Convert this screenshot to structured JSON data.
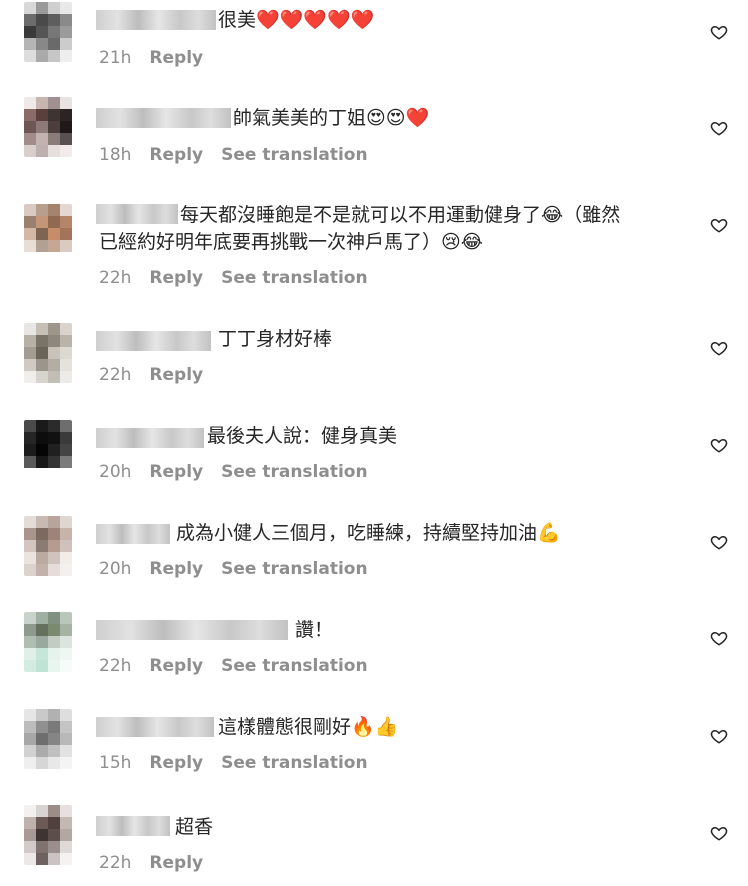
{
  "labels": {
    "reply": "Reply",
    "translate": "See translation"
  },
  "icons": {
    "like": "heart-outline-icon"
  },
  "comments": [
    {
      "text": "很美❤️❤️❤️❤️❤️",
      "time": "21h",
      "translate": false
    },
    {
      "text": "帥氣美美的丁姐😍😍❤️",
      "time": "18h",
      "translate": true
    },
    {
      "text": "每天都沒睡飽是不是就可以不用運動健身了😂（雖然",
      "text2": "已經約好明年底要再挑戰一次神戶馬了）😢😂",
      "time": "22h",
      "translate": true
    },
    {
      "text": "丁丁身材好棒",
      "time": "22h",
      "translate": false
    },
    {
      "text": "最後夫人說：健身真美",
      "time": "20h",
      "translate": true
    },
    {
      "text": "成為小健人三個月，吃睡練，持續堅持加油💪",
      "time": "20h",
      "translate": true
    },
    {
      "text": "讚！",
      "time": "22h",
      "translate": true
    },
    {
      "text": "這樣體態很剛好🔥👍",
      "time": "15h",
      "translate": true
    },
    {
      "text": "超香",
      "time": "22h",
      "translate": false
    }
  ]
}
